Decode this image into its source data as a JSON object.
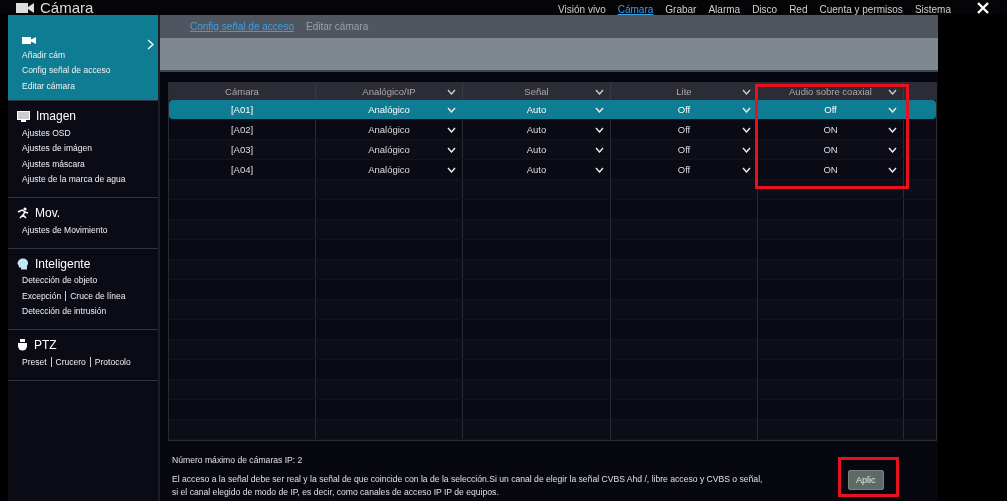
{
  "window": {
    "title": "Cámara"
  },
  "top_menu": [
    {
      "label": "Visión vivo",
      "selected": false
    },
    {
      "label": "Cámara",
      "selected": true
    },
    {
      "label": "Grabar",
      "selected": false
    },
    {
      "label": "Alarma",
      "selected": false
    },
    {
      "label": "Disco",
      "selected": false
    },
    {
      "label": "Red",
      "selected": false
    },
    {
      "label": "Cuenta y permisos",
      "selected": false
    },
    {
      "label": "Sistema",
      "selected": false
    }
  ],
  "sub_tabs": [
    {
      "label": "Config señal de acceso",
      "selected": true
    },
    {
      "label": "Editar cámara",
      "selected": false
    }
  ],
  "sidebar": {
    "sections": [
      {
        "kind": "camera",
        "expanded": true,
        "lines": [
          [
            "Añadir cám"
          ],
          [
            "Config señal de acceso"
          ],
          [
            "Editar cámara"
          ]
        ]
      },
      {
        "kind": "image",
        "title": "Imagen",
        "expanded": false,
        "lines": [
          [
            "Ajustes OSD"
          ],
          [
            "Ajustes de imágen"
          ],
          [
            "Ajustes máscara"
          ],
          [
            "Ajuste de la marca de agua"
          ]
        ]
      },
      {
        "kind": "motion",
        "title": "Mov.",
        "expanded": false,
        "lines": [
          [
            "Ajustes de Movimiento"
          ]
        ]
      },
      {
        "kind": "smart",
        "title": "Inteligente",
        "expanded": false,
        "lines": [
          [
            "Detección de objeto"
          ],
          [
            "Excepción",
            "Cruce de línea"
          ],
          [
            "Detección de intrusión"
          ]
        ]
      },
      {
        "kind": "ptz",
        "title": "PTZ",
        "expanded": false,
        "lines": [
          [
            "Preset",
            "Crucero",
            "Protocolo"
          ]
        ]
      }
    ]
  },
  "table": {
    "columns": [
      {
        "label": "Cámara",
        "dropdown": false,
        "highlighted": false
      },
      {
        "label": "Analógico/IP",
        "dropdown": true,
        "highlighted": false
      },
      {
        "label": "Señal",
        "dropdown": true,
        "highlighted": false
      },
      {
        "label": "Lite",
        "dropdown": true,
        "highlighted": false
      },
      {
        "label": "Audio sobre coaxial",
        "dropdown": true,
        "highlighted": true
      }
    ],
    "rows": [
      {
        "selected": true,
        "cells": [
          "[A01]",
          "Analógico",
          "Auto",
          "Off",
          "Off"
        ]
      },
      {
        "selected": false,
        "cells": [
          "[A02]",
          "Analógico",
          "Auto",
          "Off",
          "ON"
        ]
      },
      {
        "selected": false,
        "cells": [
          "[A03]",
          "Analógico",
          "Auto",
          "Off",
          "ON"
        ]
      },
      {
        "selected": false,
        "cells": [
          "[A04]",
          "Analógico",
          "Auto",
          "Off",
          "ON"
        ]
      }
    ]
  },
  "notes": [
    "Número máximo de cámaras IP: 2",
    "El acceso a la señal debe ser real y la señal de que coincide con la de la selección.Si un canal de elegir la señal CVBS Ahd /, libre acceso y CVBS o señal,",
    "si el canal elegido de modo de IP, es decir, como canales de acceso IP IP de equipos."
  ],
  "apply_button": {
    "label": "Aplic",
    "highlighted": true
  }
}
